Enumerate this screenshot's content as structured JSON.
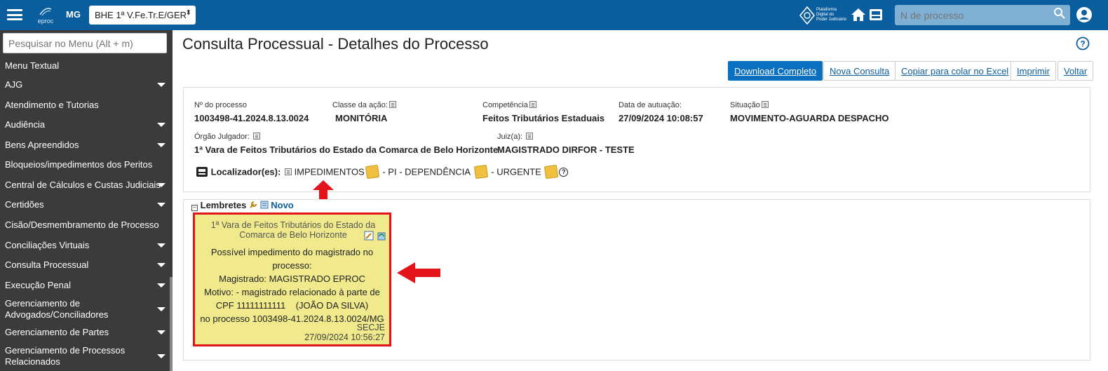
{
  "topbar": {
    "logo_text": "eproc",
    "uf": "MG",
    "unit_select": "BHE 1ª V.Fe.Tr.E/GER",
    "pdpj_text": [
      "Plataforma",
      "Digital do",
      "Poder Judiciário"
    ],
    "search_placeholder": "N de processo"
  },
  "sidebar": {
    "search_placeholder": "Pesquisar no Menu (Alt + m)",
    "items": [
      {
        "label": "Menu Textual",
        "caret": false
      },
      {
        "label": "AJG",
        "caret": true
      },
      {
        "label": "Atendimento e Tutorias",
        "caret": false
      },
      {
        "label": "Audiência",
        "caret": true
      },
      {
        "label": "Bens Apreendidos",
        "caret": true
      },
      {
        "label": "Bloqueios/impedimentos dos Peritos",
        "caret": false
      },
      {
        "label": "Central de Cálculos e Custas Judiciais",
        "caret": true
      },
      {
        "label": "Certidões",
        "caret": true
      },
      {
        "label": "Cisão/Desmembramento de Processo",
        "caret": false
      },
      {
        "label": "Conciliações Virtuais",
        "caret": true
      },
      {
        "label": "Consulta Processual",
        "caret": true
      },
      {
        "label": "Execução Penal",
        "caret": true
      },
      {
        "label": "Gerenciamento de Advogados/Conciliadores",
        "caret": true
      },
      {
        "label": "Gerenciamento de Partes",
        "caret": true
      },
      {
        "label": "Gerenciamento de Processos Relacionados",
        "caret": true
      }
    ]
  },
  "main": {
    "title": "Consulta Processual - Detalhes do Processo",
    "buttons": {
      "download": "Download Completo",
      "nova": "Nova Consulta",
      "copiar": "Copiar para colar no Excel",
      "imprimir": "Imprimir",
      "voltar": "Voltar"
    },
    "details": {
      "numero_label": "Nº do processo",
      "numero": "1003498-41.2024.8.13.0024",
      "classe_label": "Classe da ação:",
      "classe": "MONITÓRIA",
      "competencia_label": "Competência",
      "competencia": "Feitos Tributários Estaduais",
      "data_label": "Data de autuação:",
      "data": "27/09/2024 10:08:57",
      "situacao_label": "Situação",
      "situacao": "MOVIMENTO-AGUARDA DESPACHO",
      "orgao_label": "Órgão Julgador:",
      "orgao": "1ª Vara de Feitos Tributários do Estado da Comarca de Belo Horizonte",
      "juiz_label": "Juiz(a):",
      "juiz": "MAGISTRADO DIRFOR - TESTE",
      "localizador_label": "Localizador(es):",
      "loc1": "IMPEDIMENTOS",
      "loc2": "- PI - DEPENDÊNCIA",
      "loc3": "- URGENTE"
    },
    "lembretes": {
      "title": "Lembretes",
      "novo": "Novo",
      "note": {
        "org": "1ª Vara de Feitos Tributários do Estado da Comarca de Belo Horizonte",
        "line1": "Possível impedimento do magistrado no",
        "line2": "processo:",
        "line3": "Magistrado: MAGISTRADO EPROC",
        "line4": "Motivo: - magistrado relacionado à parte de",
        "line5": "CPF 11111111111    (JOÃO DA SILVA)",
        "line6": "no processo 1003498-41.2024.8.13.0024/MG",
        "sector": "SECJE",
        "timestamp": "27/09/2024 10:56:27"
      }
    }
  },
  "colors": {
    "topbar": "#0b5e9e",
    "sidebar": "#3b3b3b",
    "primary_button": "#0b6fbf",
    "note_bg": "#f0ea8c",
    "highlight_red": "#e3151b"
  }
}
